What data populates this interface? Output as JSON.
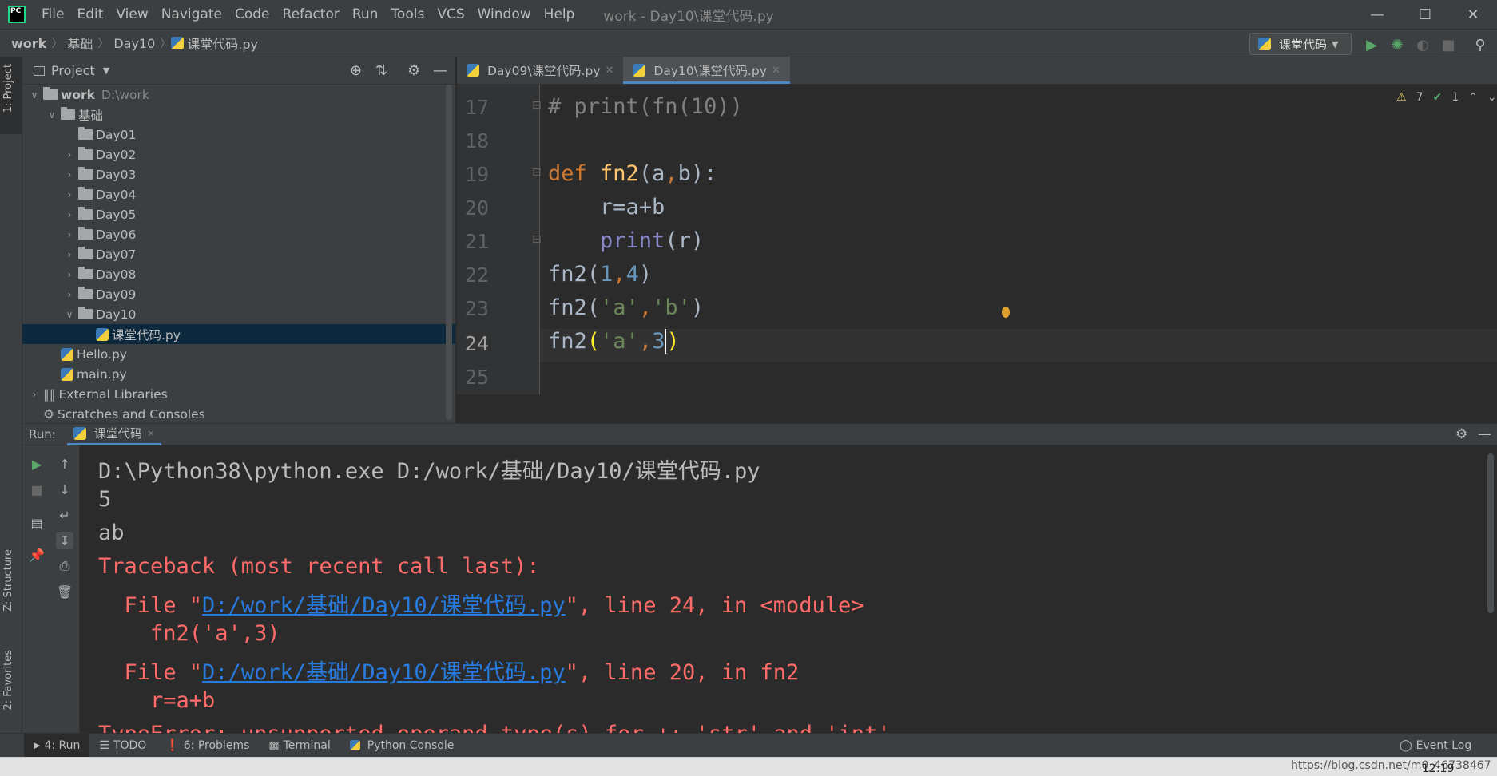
{
  "menu": {
    "logo": "PC",
    "items": [
      "File",
      "Edit",
      "View",
      "Navigate",
      "Code",
      "Refactor",
      "Run",
      "Tools",
      "VCS",
      "Window",
      "Help"
    ],
    "window_title": "work - Day10\\课堂代码.py"
  },
  "breadcrumb": {
    "items": [
      "work",
      "基础",
      "Day10",
      "课堂代码.py"
    ],
    "run_config": "课堂代码"
  },
  "side_labels": {
    "project": "1: Project",
    "structure": "Z: Structure",
    "favorites": "2: Favorites"
  },
  "project": {
    "title": "Project",
    "tree": [
      {
        "label": "work",
        "suffix": "D:\\work",
        "indent": 0,
        "arrow": "v",
        "type": "folder",
        "bold": true
      },
      {
        "label": "基础",
        "suffix": "",
        "indent": 1,
        "arrow": "v",
        "type": "folder"
      },
      {
        "label": "Day01",
        "suffix": "",
        "indent": 2,
        "arrow": "",
        "type": "folder"
      },
      {
        "label": "Day02",
        "suffix": "",
        "indent": 2,
        "arrow": ">",
        "type": "folder"
      },
      {
        "label": "Day03",
        "suffix": "",
        "indent": 2,
        "arrow": ">",
        "type": "folder"
      },
      {
        "label": "Day04",
        "suffix": "",
        "indent": 2,
        "arrow": ">",
        "type": "folder"
      },
      {
        "label": "Day05",
        "suffix": "",
        "indent": 2,
        "arrow": ">",
        "type": "folder"
      },
      {
        "label": "Day06",
        "suffix": "",
        "indent": 2,
        "arrow": ">",
        "type": "folder"
      },
      {
        "label": "Day07",
        "suffix": "",
        "indent": 2,
        "arrow": ">",
        "type": "folder"
      },
      {
        "label": "Day08",
        "suffix": "",
        "indent": 2,
        "arrow": ">",
        "type": "folder"
      },
      {
        "label": "Day09",
        "suffix": "",
        "indent": 2,
        "arrow": ">",
        "type": "folder"
      },
      {
        "label": "Day10",
        "suffix": "",
        "indent": 2,
        "arrow": "v",
        "type": "folder"
      },
      {
        "label": "课堂代码.py",
        "suffix": "",
        "indent": 3,
        "arrow": "",
        "type": "py",
        "selected": true
      },
      {
        "label": "Hello.py",
        "suffix": "",
        "indent": 1,
        "arrow": "",
        "type": "py"
      },
      {
        "label": "main.py",
        "suffix": "",
        "indent": 1,
        "arrow": "",
        "type": "py"
      },
      {
        "label": "External Libraries",
        "suffix": "",
        "indent": 0,
        "arrow": ">",
        "type": "lib"
      },
      {
        "label": "Scratches and Consoles",
        "suffix": "",
        "indent": 0,
        "arrow": "",
        "type": "scratch"
      }
    ]
  },
  "tabs": [
    {
      "label": "Day09\\课堂代码.py",
      "active": false
    },
    {
      "label": "Day10\\课堂代码.py",
      "active": true
    }
  ],
  "inspections": {
    "warnings": "7",
    "ok": "1"
  },
  "editor_lines": [
    "17",
    "18",
    "19",
    "20",
    "21",
    "22",
    "23",
    "24",
    "25"
  ],
  "run": {
    "label": "Run:",
    "tab": "课堂代码",
    "command": "D:\\Python38\\python.exe D:/work/基础/Day10/课堂代码.py",
    "out1": "5",
    "out2": "ab",
    "traceback": "Traceback (most recent call last):",
    "file_prefix": "  File \"",
    "file_link": "D:/work/基础/Day10/课堂代码.py",
    "line24": "\", line 24, in <module>",
    "code24": "    fn2('a',3)",
    "line20": "\", line 20, in fn2",
    "code20": "    r=a+b",
    "partial": "TypeError: unsupported operand type(s) for +: 'str' and 'int'"
  },
  "bottom": {
    "run": "4: Run",
    "todo": "TODO",
    "problems": "6: Problems",
    "terminal": "Terminal",
    "pyconsole": "Python Console",
    "eventlog": "Event Log"
  },
  "taskbar": {
    "url": "https://blog.csdn.net/m0_46738467",
    "time": "12:19"
  }
}
